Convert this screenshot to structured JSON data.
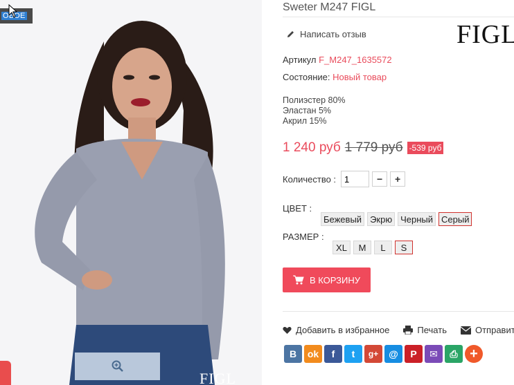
{
  "product": {
    "title": "Sweter M247 FIGL",
    "brand_logo": "FIGL",
    "badge": "ОВОЕ",
    "review_link": "Написать отзыв",
    "article_label": "Артикул",
    "article_value": "F_M247_1635572",
    "condition_label": "Состояние:",
    "condition_value": "Новый товар",
    "composition": [
      "Полиэстер 80%",
      "Эластан 5%",
      "Акрил 15%"
    ],
    "price_new": "1 240 руб",
    "price_old": "1 779 руб",
    "discount": "-539 руб",
    "quantity_label": "Количество :",
    "quantity_value": "1",
    "color_label": "ЦВЕТ :",
    "colors": [
      "Бежевый",
      "Экрю",
      "Черный",
      "Серый"
    ],
    "color_selected": "Серый",
    "size_label": "РАЗМЕР :",
    "sizes": [
      "XL",
      "M",
      "L",
      "S"
    ],
    "size_selected": "S",
    "cart_button": "В КОРЗИНУ",
    "wishlist": "Добавить в избранное",
    "print": "Печать",
    "send": "Отправить др"
  },
  "icons": {
    "review": "pencil-icon",
    "zoom": "zoom-in-icon",
    "cart": "cart-icon",
    "wishlist": "heart-icon",
    "print": "printer-icon",
    "send": "envelope-icon"
  },
  "social": [
    {
      "name": "vkontakte",
      "glyph": "В",
      "color": "#4c75a3"
    },
    {
      "name": "odnoklassniki",
      "glyph": "ok",
      "color": "#f28b1d"
    },
    {
      "name": "facebook",
      "glyph": "f",
      "color": "#3b5998"
    },
    {
      "name": "twitter",
      "glyph": "t",
      "color": "#1da1f2"
    },
    {
      "name": "google-plus",
      "glyph": "g+",
      "color": "#d34836"
    },
    {
      "name": "mail-ru",
      "glyph": "@",
      "color": "#168de2"
    },
    {
      "name": "pinterest",
      "glyph": "P",
      "color": "#cb2027"
    },
    {
      "name": "email",
      "glyph": "✉",
      "color": "#7b4bb7"
    },
    {
      "name": "print",
      "glyph": "⎙",
      "color": "#2aa566"
    },
    {
      "name": "more",
      "glyph": "+",
      "color": "#f0592a"
    }
  ],
  "colors": {
    "accent": "#ea4b5c",
    "selected_border": "#d0312d"
  }
}
